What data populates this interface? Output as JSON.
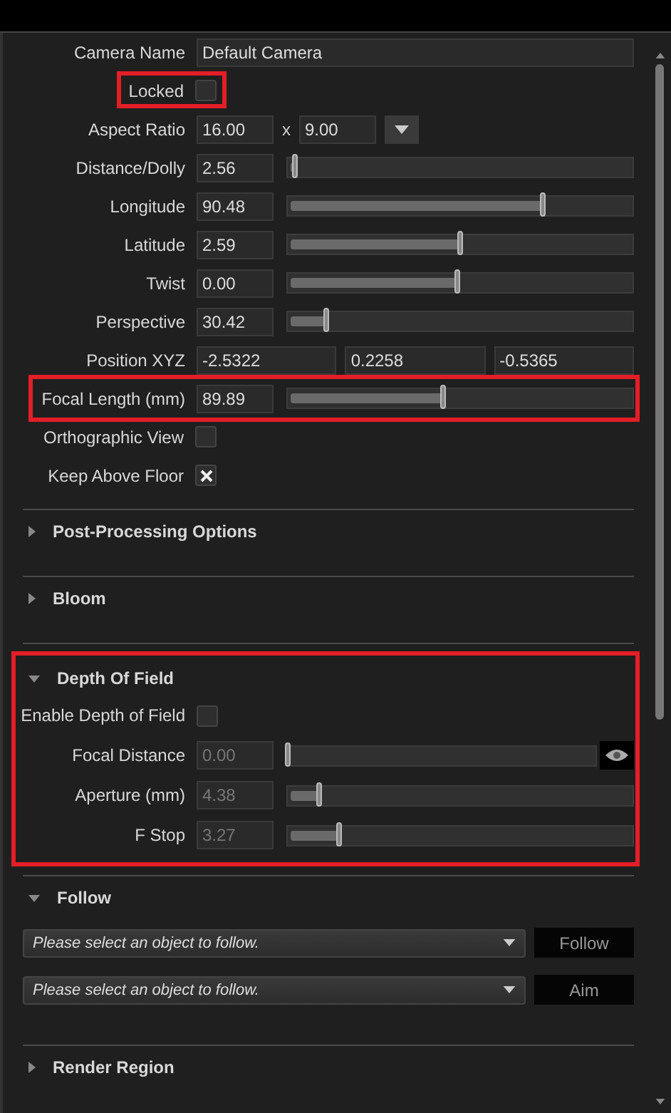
{
  "camera": {
    "rows": [
      {
        "kind": "text",
        "label": "Camera Name",
        "value": "Default Camera",
        "highlighted": false
      },
      {
        "kind": "checkbox",
        "label": "Locked",
        "checked": false,
        "highlighted": true
      },
      {
        "kind": "ratio",
        "label": "Aspect Ratio",
        "values": [
          "16.00",
          "9.00"
        ],
        "separator": "x",
        "highlighted": false
      },
      {
        "kind": "slider",
        "label": "Distance/Dolly",
        "value": "2.56",
        "level": 0.02,
        "highlighted": false
      },
      {
        "kind": "slider",
        "label": "Longitude",
        "value": "90.48",
        "level": 0.74,
        "highlighted": false
      },
      {
        "kind": "slider",
        "label": "Latitude",
        "value": "2.59",
        "level": 0.5,
        "highlighted": false
      },
      {
        "kind": "slider",
        "label": "Twist",
        "value": "0.00",
        "level": 0.49,
        "highlighted": false
      },
      {
        "kind": "slider",
        "label": "Perspective",
        "value": "30.42",
        "level": 0.11,
        "highlighted": false
      },
      {
        "kind": "xyz",
        "label": "Position XYZ",
        "values": [
          "-2.5322",
          "0.2258",
          "-0.5365"
        ],
        "highlighted": false
      },
      {
        "kind": "slider",
        "label": "Focal Length (mm)",
        "value": "89.89",
        "level": 0.45,
        "highlighted": true
      },
      {
        "kind": "checkbox",
        "label": "Orthographic View",
        "checked": false,
        "highlighted": false
      },
      {
        "kind": "checkbox",
        "label": "Keep Above Floor",
        "checked": true,
        "highlighted": false
      }
    ]
  },
  "sections": [
    {
      "title": "Post-Processing Options",
      "expanded": false,
      "highlighted": false
    },
    {
      "title": "Bloom",
      "expanded": false,
      "highlighted": false
    },
    {
      "title": "Depth Of Field",
      "expanded": true,
      "highlighted": true,
      "rows": [
        {
          "kind": "checkbox",
          "label": "Enable Depth of Field",
          "checked": false,
          "disabled": false
        },
        {
          "kind": "slider",
          "label": "Focal Distance",
          "value": "0.00",
          "level": 0.0,
          "disabled": true,
          "picker": true
        },
        {
          "kind": "slider",
          "label": "Aperture (mm)",
          "value": "4.38",
          "level": 0.09,
          "disabled": true,
          "picker": false
        },
        {
          "kind": "slider",
          "label": "F Stop",
          "value": "3.27",
          "level": 0.15,
          "disabled": true,
          "picker": false
        }
      ]
    },
    {
      "title": "Follow",
      "expanded": true,
      "highlighted": false,
      "pickers": [
        {
          "placeholder": "Please select an object to follow.",
          "button": "Follow"
        },
        {
          "placeholder": "Please select an object to follow.",
          "button": "Aim"
        }
      ]
    },
    {
      "title": "Render Region",
      "expanded": false,
      "highlighted": false
    }
  ]
}
